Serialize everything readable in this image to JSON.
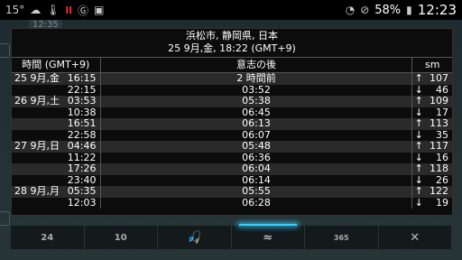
{
  "status_bar": {
    "left_text": "15°",
    "red_label": "ll",
    "right_time": "12:23",
    "battery": "58%",
    "icons_left": [
      "cloud-icon",
      "temperature-icon",
      "signal-red-icon",
      "g-icon",
      "image-icon"
    ],
    "icons_right": [
      "wifi-icon",
      "no-sim-icon",
      "battery-icon"
    ]
  },
  "background": {
    "time_label": "12:35"
  },
  "dialog": {
    "title": "浜松市, 静岡県, 日本",
    "subtitle": "25 9月,金, 18:22 (GMT+9)",
    "columns": {
      "time": "時間 (GMT+9)",
      "since": "意志の後",
      "unit": "sm"
    },
    "rows": [
      {
        "day": "25 9月,金",
        "time": "16:15",
        "since": "2 時間前",
        "arrow": "↑",
        "value": "107"
      },
      {
        "day": "",
        "time": "22:15",
        "since": "03:52",
        "arrow": "↓",
        "value": "46"
      },
      {
        "day": "26 9月,土",
        "time": "03:53",
        "since": "05:38",
        "arrow": "↑",
        "value": "109"
      },
      {
        "day": "",
        "time": "10:38",
        "since": "06:45",
        "arrow": "↓",
        "value": "17"
      },
      {
        "day": "",
        "time": "16:51",
        "since": "06:13",
        "arrow": "↑",
        "value": "113"
      },
      {
        "day": "",
        "time": "22:58",
        "since": "06:07",
        "arrow": "↓",
        "value": "35"
      },
      {
        "day": "27 9月,日",
        "time": "04:46",
        "since": "05:48",
        "arrow": "↑",
        "value": "117"
      },
      {
        "day": "",
        "time": "11:22",
        "since": "06:36",
        "arrow": "↓",
        "value": "16"
      },
      {
        "day": "",
        "time": "17:26",
        "since": "06:04",
        "arrow": "↑",
        "value": "118"
      },
      {
        "day": "",
        "time": "23:40",
        "since": "06:14",
        "arrow": "↓",
        "value": "26"
      },
      {
        "day": "28 9月,月",
        "time": "05:35",
        "since": "05:55",
        "arrow": "↑",
        "value": "122"
      },
      {
        "day": "",
        "time": "12:03",
        "since": "06:28",
        "arrow": "↓",
        "value": "19"
      }
    ]
  },
  "toolbar": {
    "buttons": [
      {
        "label": "24",
        "icon": ""
      },
      {
        "label": "10",
        "icon": ""
      },
      {
        "label": "",
        "icon": "fisherman-icon"
      },
      {
        "label": "",
        "icon": "waves-icon"
      },
      {
        "label": "365",
        "icon": ""
      },
      {
        "label": "",
        "icon": "close-icon"
      }
    ],
    "active_index": 3
  }
}
